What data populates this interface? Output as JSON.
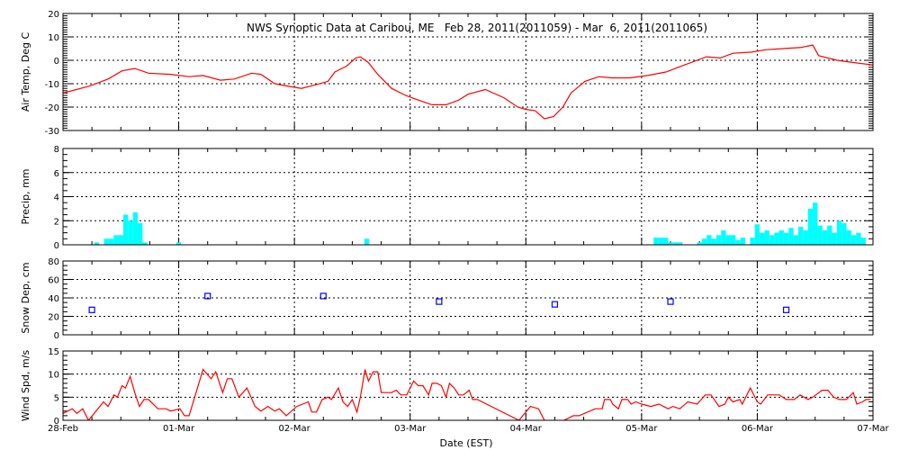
{
  "title": "NWS Synoptic Data at Caribou, ME   Feb 28, 2011(2011059) - Mar  6, 2011(2011065)",
  "colors": {
    "line": "#ff0000",
    "bar": "#00ffff",
    "marker": "#0000ff",
    "axis": "#000000"
  },
  "chart_data": [
    {
      "type": "line",
      "name": "air-temp",
      "ylabel": "Air Temp, Deg C",
      "ylim": [
        -30,
        20
      ],
      "yticks": [
        20,
        10,
        0,
        -10,
        -20,
        -30
      ],
      "grid": true,
      "points": [
        [
          0,
          -14
        ],
        [
          0.23,
          -11
        ],
        [
          0.39,
          -8
        ],
        [
          0.51,
          -4.5
        ],
        [
          0.62,
          -3.5
        ],
        [
          0.74,
          -5.5
        ],
        [
          0.93,
          -6
        ],
        [
          1.09,
          -7
        ],
        [
          1.21,
          -6.5
        ],
        [
          1.36,
          -8.5
        ],
        [
          1.48,
          -8
        ],
        [
          1.63,
          -5.5
        ],
        [
          1.71,
          -6
        ],
        [
          1.83,
          -10
        ],
        [
          1.94,
          -11
        ],
        [
          2.06,
          -12
        ],
        [
          2.18,
          -10.5
        ],
        [
          2.29,
          -9
        ],
        [
          2.35,
          -5
        ],
        [
          2.45,
          -2.5
        ],
        [
          2.53,
          1
        ],
        [
          2.57,
          1.5
        ],
        [
          2.64,
          -1
        ],
        [
          2.72,
          -6
        ],
        [
          2.84,
          -12
        ],
        [
          2.96,
          -15
        ],
        [
          3.07,
          -17
        ],
        [
          3.19,
          -19
        ],
        [
          3.31,
          -19
        ],
        [
          3.42,
          -17
        ],
        [
          3.5,
          -14.5
        ],
        [
          3.65,
          -12.5
        ],
        [
          3.81,
          -16
        ],
        [
          3.93,
          -20
        ],
        [
          4.0,
          -21
        ],
        [
          4.08,
          -21.5
        ],
        [
          4.16,
          -25
        ],
        [
          4.24,
          -24
        ],
        [
          4.32,
          -20
        ],
        [
          4.39,
          -14
        ],
        [
          4.51,
          -9
        ],
        [
          4.63,
          -7
        ],
        [
          4.74,
          -7.5
        ],
        [
          4.9,
          -7.5
        ],
        [
          5.05,
          -6.5
        ],
        [
          5.21,
          -5
        ],
        [
          5.37,
          -2
        ],
        [
          5.56,
          1.5
        ],
        [
          5.68,
          1
        ],
        [
          5.79,
          3
        ],
        [
          5.95,
          3.5
        ],
        [
          6.07,
          4.5
        ],
        [
          6.22,
          5
        ],
        [
          6.38,
          5.5
        ],
        [
          6.48,
          6.5
        ],
        [
          6.53,
          2
        ],
        [
          6.69,
          0
        ],
        [
          6.84,
          -1
        ],
        [
          7.0,
          -2
        ]
      ]
    },
    {
      "type": "bar",
      "name": "precip",
      "ylabel": "Precip, mm",
      "ylim": [
        0,
        8
      ],
      "yticks": [
        8,
        6,
        4,
        2,
        0
      ],
      "grid": true,
      "bar_width_hours": 1,
      "points": [
        [
          7,
          0.2
        ],
        [
          9,
          0.5
        ],
        [
          10,
          0.5
        ],
        [
          11,
          0.8
        ],
        [
          12,
          0.8
        ],
        [
          13,
          2.5
        ],
        [
          14,
          2.0
        ],
        [
          15,
          2.7
        ],
        [
          16,
          1.8
        ],
        [
          17,
          0.2
        ],
        [
          24,
          0.2
        ],
        [
          63,
          0.5
        ],
        [
          123,
          0.6
        ],
        [
          124,
          0.6
        ],
        [
          125,
          0.6
        ],
        [
          126,
          0.2
        ],
        [
          127,
          0.2
        ],
        [
          128,
          0.2
        ],
        [
          132,
          0.2
        ],
        [
          133,
          0.5
        ],
        [
          134,
          0.8
        ],
        [
          135,
          0.5
        ],
        [
          136,
          0.8
        ],
        [
          137,
          1.2
        ],
        [
          138,
          0.8
        ],
        [
          139,
          0.8
        ],
        [
          140,
          0.4
        ],
        [
          141,
          0.6
        ],
        [
          143,
          0.6
        ],
        [
          144,
          1.7
        ],
        [
          145,
          1.0
        ],
        [
          146,
          1.2
        ],
        [
          147,
          0.8
        ],
        [
          148,
          1.0
        ],
        [
          149,
          1.2
        ],
        [
          150,
          1.0
        ],
        [
          151,
          1.4
        ],
        [
          152,
          0.8
        ],
        [
          153,
          1.5
        ],
        [
          154,
          1.2
        ],
        [
          155,
          3.0
        ],
        [
          156,
          3.5
        ],
        [
          157,
          1.6
        ],
        [
          158,
          1.2
        ],
        [
          159,
          1.6
        ],
        [
          160,
          1.0
        ],
        [
          161,
          2.0
        ],
        [
          162,
          1.8
        ],
        [
          163,
          1.2
        ],
        [
          164,
          0.8
        ],
        [
          165,
          1.0
        ],
        [
          166,
          0.6
        ]
      ]
    },
    {
      "type": "scatter",
      "name": "snow-depth",
      "ylabel": "Snow Dep, cm",
      "ylim": [
        0,
        80
      ],
      "yticks": [
        80,
        60,
        40,
        20,
        0
      ],
      "grid": true,
      "points": [
        [
          0.25,
          27
        ],
        [
          1.25,
          42
        ],
        [
          2.25,
          42
        ],
        [
          3.25,
          36
        ],
        [
          4.25,
          33
        ],
        [
          5.25,
          36
        ],
        [
          6.25,
          27
        ]
      ]
    },
    {
      "type": "line",
      "name": "wind-speed",
      "ylabel": "Wind Spd, m/s",
      "ylim": [
        0,
        15
      ],
      "yticks": [
        15,
        10,
        5,
        0
      ],
      "grid": true,
      "xlabel": "Date (EST)",
      "xticks": [
        "28-Feb",
        "01-Mar",
        "02-Mar",
        "03-Mar",
        "04-Mar",
        "05-Mar",
        "06-Mar",
        "07-Mar"
      ],
      "points": [
        [
          0,
          1.5
        ],
        [
          0.08,
          2.5
        ],
        [
          0.12,
          1.5
        ],
        [
          0.17,
          2.5
        ],
        [
          0.22,
          0
        ],
        [
          0.27,
          1.5
        ],
        [
          0.35,
          4
        ],
        [
          0.39,
          3
        ],
        [
          0.44,
          5.5
        ],
        [
          0.47,
          5
        ],
        [
          0.51,
          7.5
        ],
        [
          0.54,
          7
        ],
        [
          0.58,
          9.5
        ],
        [
          0.62,
          6
        ],
        [
          0.66,
          3
        ],
        [
          0.7,
          4.5
        ],
        [
          0.74,
          4.5
        ],
        [
          0.82,
          2.5
        ],
        [
          0.89,
          2.5
        ],
        [
          0.93,
          2
        ],
        [
          1.01,
          2.5
        ],
        [
          1.05,
          1
        ],
        [
          1.09,
          1
        ],
        [
          1.21,
          11
        ],
        [
          1.28,
          9
        ],
        [
          1.32,
          10.5
        ],
        [
          1.38,
          6
        ],
        [
          1.42,
          9
        ],
        [
          1.46,
          9
        ],
        [
          1.52,
          5
        ],
        [
          1.59,
          7
        ],
        [
          1.66,
          3
        ],
        [
          1.71,
          2
        ],
        [
          1.77,
          3
        ],
        [
          1.83,
          2
        ],
        [
          1.87,
          2.5
        ],
        [
          1.93,
          1
        ],
        [
          2.02,
          3
        ],
        [
          2.12,
          4
        ],
        [
          2.15,
          1.8
        ],
        [
          2.19,
          1.8
        ],
        [
          2.24,
          4.5
        ],
        [
          2.29,
          5
        ],
        [
          2.32,
          4.5
        ],
        [
          2.38,
          7
        ],
        [
          2.42,
          4
        ],
        [
          2.46,
          3
        ],
        [
          2.5,
          4.5
        ],
        [
          2.54,
          1.8
        ],
        [
          2.57,
          5
        ],
        [
          2.61,
          11
        ],
        [
          2.64,
          8.5
        ],
        [
          2.68,
          10.5
        ],
        [
          2.72,
          10.5
        ],
        [
          2.75,
          6
        ],
        [
          2.84,
          6
        ],
        [
          2.88,
          6.5
        ],
        [
          2.92,
          5.5
        ],
        [
          2.97,
          5.5
        ],
        [
          3.03,
          8.5
        ],
        [
          3.07,
          7.5
        ],
        [
          3.11,
          7.5
        ],
        [
          3.16,
          5.5
        ],
        [
          3.19,
          8
        ],
        [
          3.23,
          8
        ],
        [
          3.27,
          7.5
        ],
        [
          3.31,
          5
        ],
        [
          3.34,
          8
        ],
        [
          3.38,
          7
        ],
        [
          3.42,
          5.5
        ],
        [
          3.46,
          5.5
        ],
        [
          3.51,
          6.5
        ],
        [
          3.54,
          4.5
        ],
        [
          3.58,
          4.5
        ],
        [
          3.94,
          0
        ],
        [
          4.04,
          3
        ],
        [
          4.11,
          2.5
        ],
        [
          4.16,
          0
        ],
        [
          4.23,
          -1
        ],
        [
          4.29,
          -1
        ],
        [
          4.33,
          0
        ],
        [
          4.41,
          1
        ],
        [
          4.46,
          1
        ],
        [
          4.6,
          2.5
        ],
        [
          4.66,
          2.5
        ],
        [
          4.68,
          4.5
        ],
        [
          4.73,
          4.5
        ],
        [
          4.75,
          3.5
        ],
        [
          4.8,
          2.5
        ],
        [
          4.83,
          4.5
        ],
        [
          4.88,
          4.5
        ],
        [
          4.91,
          3.5
        ],
        [
          4.95,
          4
        ],
        [
          5.0,
          3.5
        ],
        [
          5.08,
          3
        ],
        [
          5.15,
          3.5
        ],
        [
          5.23,
          2.5
        ],
        [
          5.27,
          3
        ],
        [
          5.33,
          2.5
        ],
        [
          5.4,
          4
        ],
        [
          5.48,
          3.5
        ],
        [
          5.55,
          5.5
        ],
        [
          5.6,
          5.5
        ],
        [
          5.67,
          3
        ],
        [
          5.72,
          3.5
        ],
        [
          5.75,
          5
        ],
        [
          5.79,
          4
        ],
        [
          5.85,
          4.5
        ],
        [
          5.87,
          3.5
        ],
        [
          5.94,
          7
        ],
        [
          6.0,
          4
        ],
        [
          6.03,
          3.5
        ],
        [
          6.09,
          5.5
        ],
        [
          6.19,
          5.5
        ],
        [
          6.25,
          4.5
        ],
        [
          6.32,
          4.5
        ],
        [
          6.37,
          5.5
        ],
        [
          6.44,
          4.5
        ],
        [
          6.48,
          5
        ],
        [
          6.56,
          6.5
        ],
        [
          6.61,
          6.5
        ],
        [
          6.66,
          5
        ],
        [
          6.71,
          4.5
        ],
        [
          6.77,
          4.5
        ],
        [
          6.83,
          6
        ],
        [
          6.86,
          3.5
        ],
        [
          6.91,
          4
        ],
        [
          6.94,
          4.5
        ],
        [
          6.98,
          4.5
        ]
      ]
    }
  ],
  "xrange_days": [
    0,
    7
  ]
}
